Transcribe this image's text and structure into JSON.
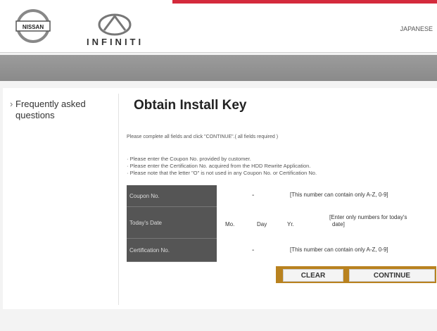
{
  "header": {
    "brand_nissan": "NISSAN",
    "brand_infiniti": "INFINITI",
    "language_link": "JAPANESE"
  },
  "sidebar": {
    "items": [
      {
        "label": "Frequently asked questions"
      }
    ]
  },
  "main": {
    "title": "Obtain Install Key",
    "instruction": "Please complete all fields and click \"CONTINUE\".( all fields required )",
    "notes": [
      "· Please enter the Coupon No. provided by customer.",
      "· Please enter the Certification No. acquired from the HDD Rewrite Application.",
      "· Please note that the letter \"O\" is not used in any Coupon No. or Certification No."
    ]
  },
  "form": {
    "coupon": {
      "label": "Coupon No.",
      "separator": "-",
      "hint": "[This number can contain only A-Z, 0-9]"
    },
    "date": {
      "label": "Today's Date",
      "month": "Mo.",
      "day": "Day",
      "year": "Yr.",
      "hint_line1": "[Enter only numbers for today's",
      "hint_line2": "date]"
    },
    "certification": {
      "label": "Certification No.",
      "separator": "-",
      "hint": "[This number can contain only A-Z, 0-9]"
    }
  },
  "buttons": {
    "clear": "CLEAR",
    "continue": "CONTINUE"
  },
  "colors": {
    "accent_red": "#d42a3c",
    "nav_gray": "#949494",
    "label_bg": "#555555",
    "button_frame": "#b9821f"
  }
}
